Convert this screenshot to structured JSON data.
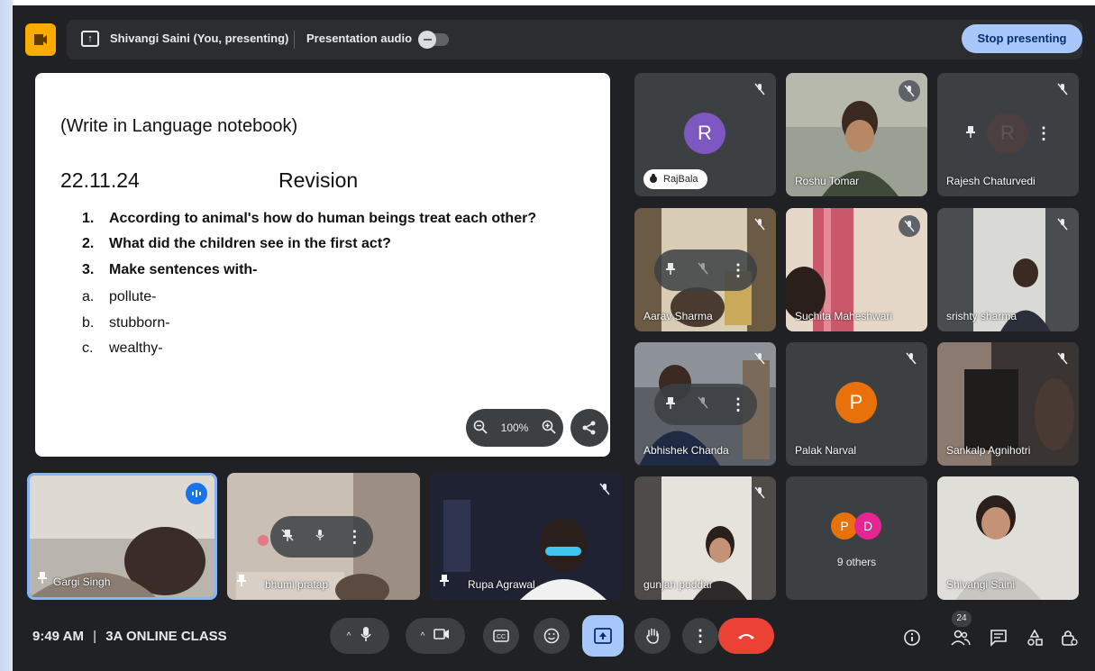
{
  "topbar": {
    "presenter_name": "Shivangi Saini (You, presenting)",
    "audio_label": "Presentation audio",
    "stop_label": "Stop presenting"
  },
  "slide": {
    "line1": "(Write in Language notebook)",
    "date": "22.11.24",
    "heading": "Revision",
    "questions": [
      {
        "num": "1.",
        "text": "According to animal's how do human beings treat each other?"
      },
      {
        "num": "2.",
        "text": "What did the children see in the first act?"
      },
      {
        "num": "3.",
        "text": "Make sentences with-"
      }
    ],
    "sub_items": [
      {
        "letter": "a.",
        "text": "pollute-"
      },
      {
        "letter": "b.",
        "text": "stubborn-"
      },
      {
        "letter": "c.",
        "text": "wealthy-"
      }
    ],
    "zoom": "100%"
  },
  "participants": {
    "rajbala": {
      "name": "RajBala",
      "initial": "R",
      "color": "#7e57c2"
    },
    "roshu": {
      "name": "Roshu Tomar"
    },
    "rajesh": {
      "name": "Rajesh Chaturvedi",
      "initial": "R",
      "color": "#b0412e"
    },
    "aarav": {
      "name": "Aarav Sharma"
    },
    "suchita": {
      "name": "Suchita Maheshwari"
    },
    "srishty": {
      "name": "srishty sharma"
    },
    "abhishek": {
      "name": "Abhishek Chanda"
    },
    "palak": {
      "name": "Palak Narval",
      "initial": "P",
      "color": "#e8710a"
    },
    "sankalp": {
      "name": "Sankalp Agnihotri"
    },
    "gunjan": {
      "name": "gunjan poddar"
    },
    "others": {
      "label": "9 others",
      "initial1": "P",
      "initial2": "D",
      "color1": "#e8710a",
      "color2": "#e52592"
    },
    "shivangi": {
      "name": "Shivangi Saini"
    },
    "gargi": {
      "name": "Gargi Singh"
    },
    "bhumi": {
      "name": "bhumi pratap"
    },
    "rupa": {
      "name": "Rupa Agrawal"
    }
  },
  "bottombar": {
    "time": "9:49 AM",
    "separator": "|",
    "meeting_name": "3A ONLINE CLASS",
    "people_count": "24"
  },
  "colors": {
    "background": "#202124",
    "accent": "#a8c7fa",
    "hangup": "#ea4335",
    "logo": "#f9ab00"
  }
}
